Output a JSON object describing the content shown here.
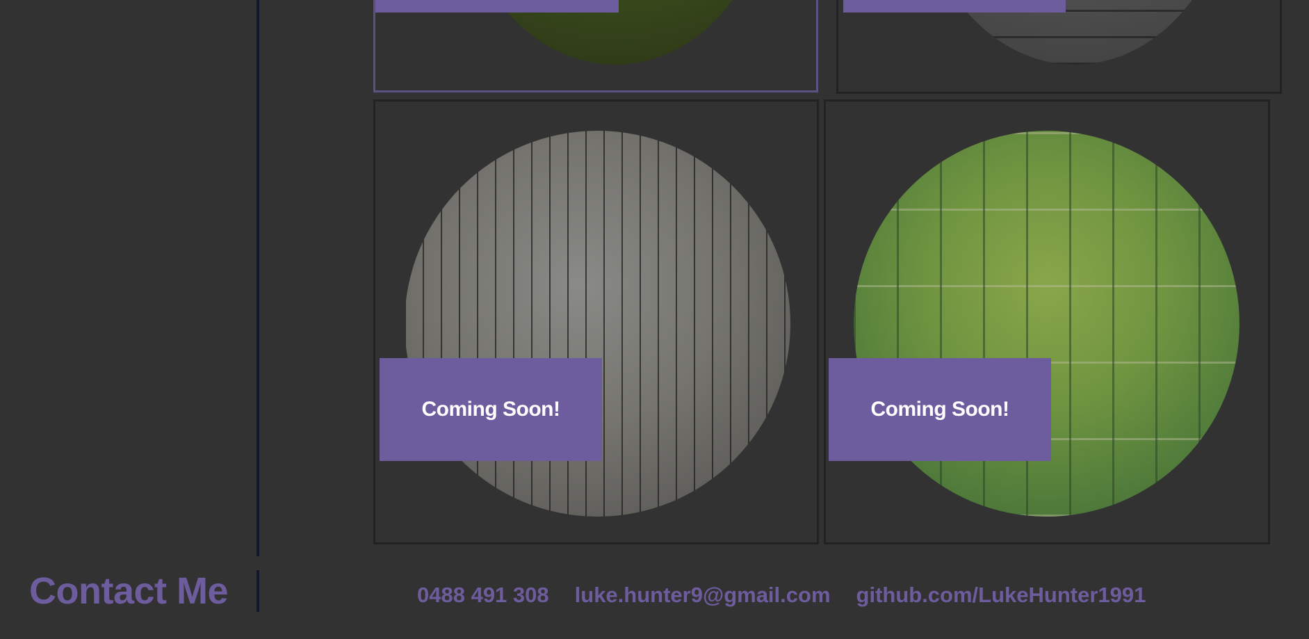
{
  "gallery": {
    "cards": [
      {
        "badge_label": "",
        "material": "moss"
      },
      {
        "badge_label": "",
        "material": "stone-bricks"
      },
      {
        "badge_label": "Coming Soon!",
        "material": "wood-planks"
      },
      {
        "badge_label": "Coming Soon!",
        "material": "green-bamboo"
      }
    ]
  },
  "contact": {
    "title": "Contact Me",
    "phone": "0488 491 308",
    "email": "luke.hunter9@gmail.com",
    "github": "github.com/LukeHunter1991"
  },
  "colors": {
    "background": "#333232",
    "accent": "#6e5d9e",
    "divider": "#14172a",
    "card_border": "#222222",
    "selected_border": "#5a5280"
  }
}
